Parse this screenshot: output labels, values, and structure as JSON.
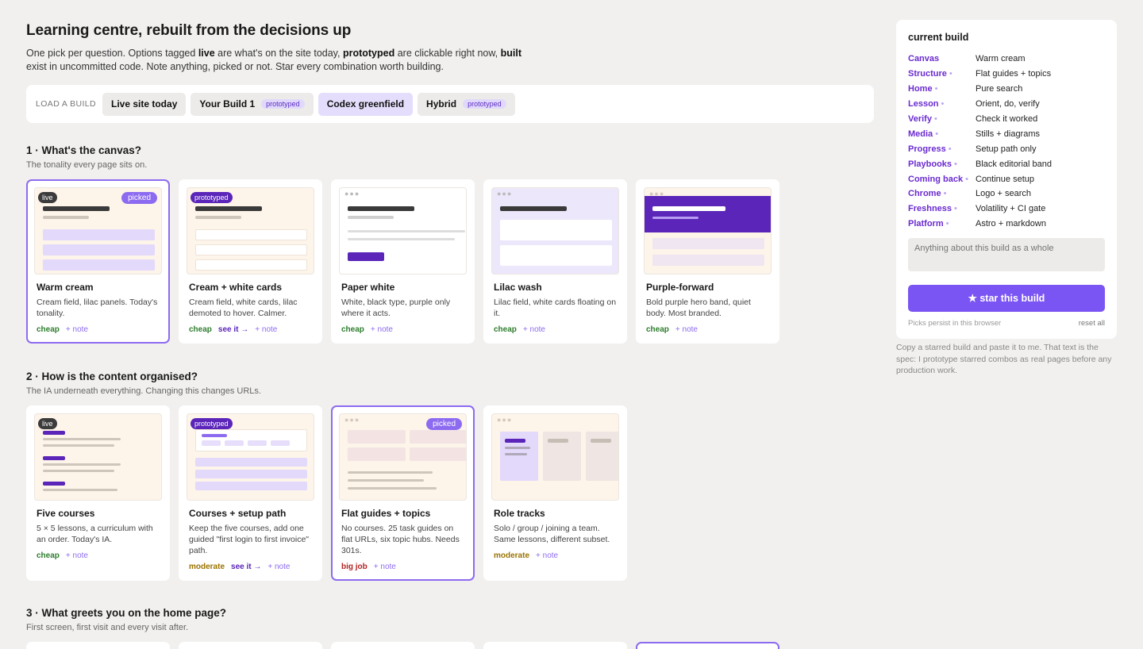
{
  "page": {
    "title": "Learning centre, rebuilt from the decisions up",
    "intro_parts": [
      "One pick per question. Options tagged ",
      "live",
      " are what's on the site today, ",
      "prototyped",
      " are clickable right now, ",
      "built",
      " exist in uncommitted code. Note anything, picked or not. Star every combination worth building."
    ]
  },
  "load_build": {
    "label": "LOAD A BUILD",
    "builds": [
      {
        "label": "Live site today",
        "tag": ""
      },
      {
        "label": "Your Build 1",
        "tag": "prototyped"
      },
      {
        "label": "Codex greenfield",
        "tag": ""
      },
      {
        "label": "Hybrid",
        "tag": "prototyped"
      }
    ]
  },
  "questions": [
    {
      "title": "1 · What's the canvas?",
      "sub": "The tonality every page sits on.",
      "options": [
        {
          "title": "Warm cream",
          "desc": "Cream field, lilac panels. Today's tonality.",
          "badge": "live",
          "picked": "picked",
          "cost": "cheap",
          "see": "",
          "note": "+ note"
        },
        {
          "title": "Cream + white cards",
          "desc": "Cream field, white cards, lilac demoted to hover. Calmer.",
          "badge": "prototyped",
          "picked": "",
          "cost": "cheap",
          "see": "see it →",
          "note": "+ note"
        },
        {
          "title": "Paper white",
          "desc": "White, black type, purple only where it acts.",
          "badge": "",
          "picked": "",
          "cost": "cheap",
          "see": "",
          "note": "+ note"
        },
        {
          "title": "Lilac wash",
          "desc": "Lilac field, white cards floating on it.",
          "badge": "",
          "picked": "",
          "cost": "cheap",
          "see": "",
          "note": "+ note"
        },
        {
          "title": "Purple-forward",
          "desc": "Bold purple hero band, quiet body. Most branded.",
          "badge": "",
          "picked": "",
          "cost": "cheap",
          "see": "",
          "note": "+ note"
        }
      ]
    },
    {
      "title": "2 · How is the content organised?",
      "sub": "The IA underneath everything. Changing this changes URLs.",
      "options": [
        {
          "title": "Five courses",
          "desc": "5 × 5 lessons, a curriculum with an order. Today's IA.",
          "badge": "live",
          "picked": "",
          "cost": "cheap",
          "see": "",
          "note": "+ note"
        },
        {
          "title": "Courses + setup path",
          "desc": "Keep the five courses, add one guided \"first login to first invoice\" path.",
          "badge": "prototyped",
          "picked": "",
          "cost": "moderate",
          "see": "see it →",
          "note": "+ note"
        },
        {
          "title": "Flat guides + topics",
          "desc": "No courses. 25 task guides on flat URLs, six topic hubs. Needs 301s.",
          "badge": "",
          "picked": "picked",
          "cost": "big job",
          "see": "",
          "note": "+ note"
        },
        {
          "title": "Role tracks",
          "desc": "Solo / group / joining a team. Same lessons, different subset.",
          "badge": "",
          "picked": "",
          "cost": "moderate",
          "see": "",
          "note": "+ note"
        }
      ]
    },
    {
      "title": "3 · What greets you on the home page?",
      "sub": "First screen, first visit and every visit after."
    }
  ],
  "sidebar": {
    "title": "current build",
    "rows": [
      {
        "k": "Canvas",
        "dot": "",
        "v": "Warm cream"
      },
      {
        "k": "Structure",
        "dot": "•",
        "v": "Flat guides + topics"
      },
      {
        "k": "Home",
        "dot": "•",
        "v": "Pure search"
      },
      {
        "k": "Lesson",
        "dot": "•",
        "v": "Orient, do, verify"
      },
      {
        "k": "Verify",
        "dot": "•",
        "v": "Check it worked"
      },
      {
        "k": "Media",
        "dot": "•",
        "v": "Stills + diagrams"
      },
      {
        "k": "Progress",
        "dot": "•",
        "v": "Setup path only"
      },
      {
        "k": "Playbooks",
        "dot": "•",
        "v": "Black editorial band"
      },
      {
        "k": "Coming back",
        "dot": "•",
        "v": "Continue setup"
      },
      {
        "k": "Chrome",
        "dot": "•",
        "v": "Logo + search"
      },
      {
        "k": "Freshness",
        "dot": "•",
        "v": "Volatility + CI gate"
      },
      {
        "k": "Platform",
        "dot": "•",
        "v": "Astro + markdown"
      }
    ],
    "note_placeholder": "Anything about this build as a whole",
    "star_label": "★ star this build",
    "persist_text": "Picks persist in this browser",
    "reset_label": "reset all",
    "caption": "Copy a starred build and paste it to me. That text is the spec: I prototype starred combos as real pages before any production work."
  },
  "colors": {
    "accent": "#7b55f3",
    "purple": "#5a25b8",
    "cream": "#fdf4ea",
    "lilac": "#e6defb"
  }
}
